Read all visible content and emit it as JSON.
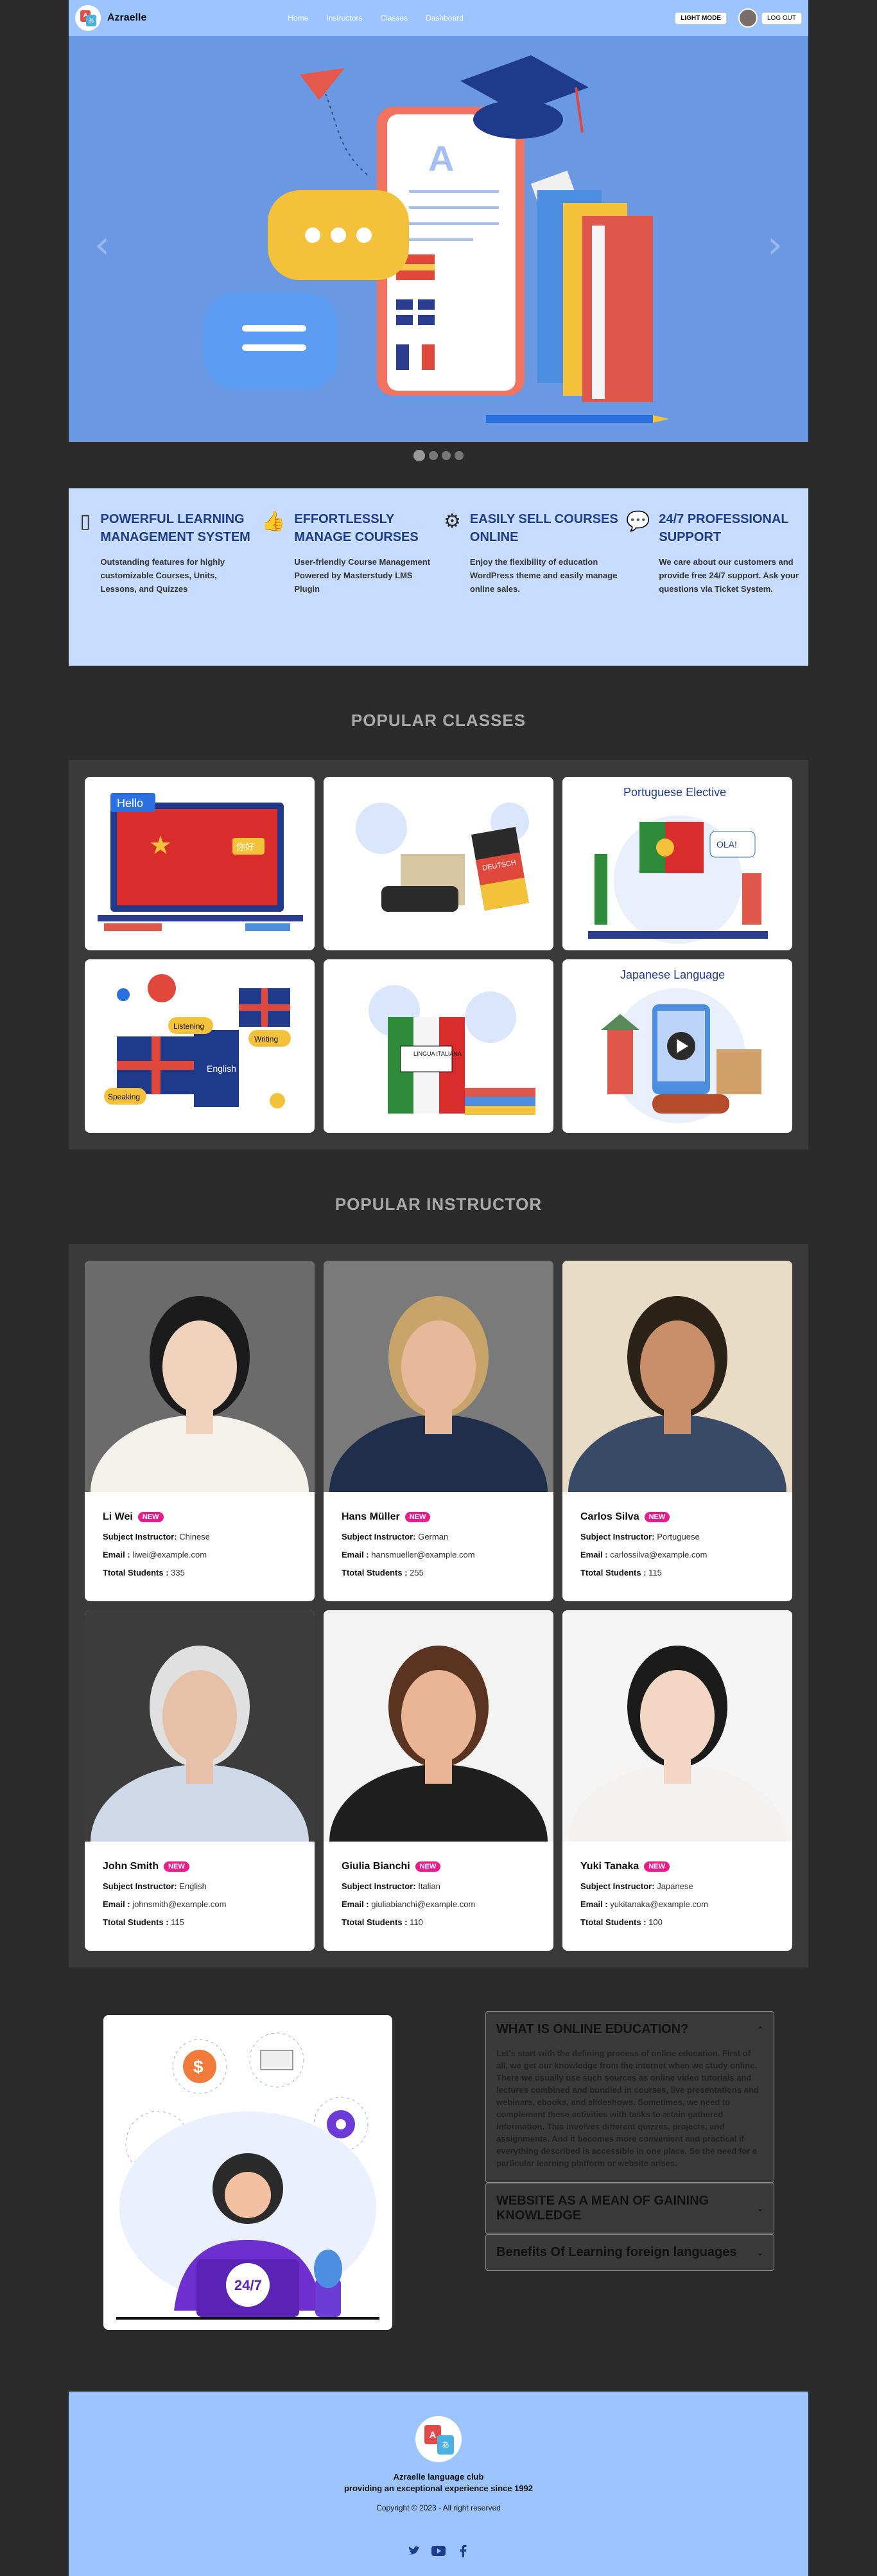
{
  "header": {
    "brand": "Azraelle",
    "nav": [
      "Home",
      "Instructors",
      "Classes",
      "Dashboard"
    ],
    "light_mode": "LIGHT MODE",
    "logout": "LOG OUT"
  },
  "hero": {
    "letter": "A"
  },
  "features": [
    {
      "icon": "phone-icon",
      "title": "POWERFUL LEARNING MANAGEMENT SYSTEM",
      "desc": "Outstanding features for highly customizable Courses, Units, Lessons, and Quizzes"
    },
    {
      "icon": "thumbs-up-icon",
      "title": "EFFORTLESSLY MANAGE COURSES",
      "desc": "User-friendly Course Management Powered by Masterstudy LMS Plugin"
    },
    {
      "icon": "gear-icon",
      "title": "EASILY SELL COURSES ONLINE",
      "desc": "Enjoy the flexibility of education WordPress theme and easily manage online sales."
    },
    {
      "icon": "chat-icon",
      "title": "24/7 PROFESSIONAL SUPPORT",
      "desc": "We care about our customers and provide free 24/7 support. Ask your questions via Ticket System."
    }
  ],
  "classes": {
    "title": "POPULAR CLASSES",
    "items": [
      {
        "label": "Hello",
        "tag": "你好"
      },
      {
        "label": "DEUTSCH"
      },
      {
        "label": "Portuguese Elective",
        "tag": "OLA!"
      },
      {
        "label": "English",
        "tags": [
          "Listening",
          "Writing",
          "Speaking"
        ]
      },
      {
        "label": "LINGUA ITALIANA"
      },
      {
        "label": "Japanese Language"
      }
    ]
  },
  "instructors": {
    "title": "POPULAR INSTRUCTOR",
    "badge": "NEW",
    "subject_label": "Subject Instructor:",
    "email_label": "Email :",
    "students_label": "Ttotal Students :",
    "items": [
      {
        "name": "Li Wei",
        "subject": "Chinese",
        "email": "liwei@example.com",
        "students": "335"
      },
      {
        "name": "Hans Müller",
        "subject": "German",
        "email": "hansmueller@example.com",
        "students": "255"
      },
      {
        "name": "Carlos Silva",
        "subject": "Portuguese",
        "email": "carlossilva@example.com",
        "students": "115"
      },
      {
        "name": "John Smith",
        "subject": "English",
        "email": "johnsmith@example.com",
        "students": "115"
      },
      {
        "name": "Giulia Bianchi",
        "subject": "Italian",
        "email": "giuliabianchi@example.com",
        "students": "110"
      },
      {
        "name": "Yuki Tanaka",
        "subject": "Japanese",
        "email": "yukitanaka@example.com",
        "students": "100"
      }
    ]
  },
  "faq": {
    "badge": "24/7",
    "items": [
      {
        "title": "WHAT IS ONLINE EDUCATION?",
        "body": "Let's start with the defining process of online education. First of all, we get our knowledge from the internet when we study online. There we usually use such sources as online video tutorials and lectures combined and bundled in courses, live presentations and webinars, ebooks, and slideshows. Sometimes, we need to complement these activities with tasks to retain gathered information. This involves different quizzes, projects, and assignments. And it becomes more convenient and practical if everything described is accessible in one place. So the need for a particular learning platform or website arises."
      },
      {
        "title": "WEBSITE AS A MEAN OF GAINING KNOWLEDGE"
      },
      {
        "title": "Benefits Of Learning foreign languages"
      }
    ]
  },
  "footer": {
    "line1": "Azraelle language club",
    "line2": "providing an exceptional experience since 1992",
    "copyright": "Copyright © 2023 - All right reserved"
  }
}
